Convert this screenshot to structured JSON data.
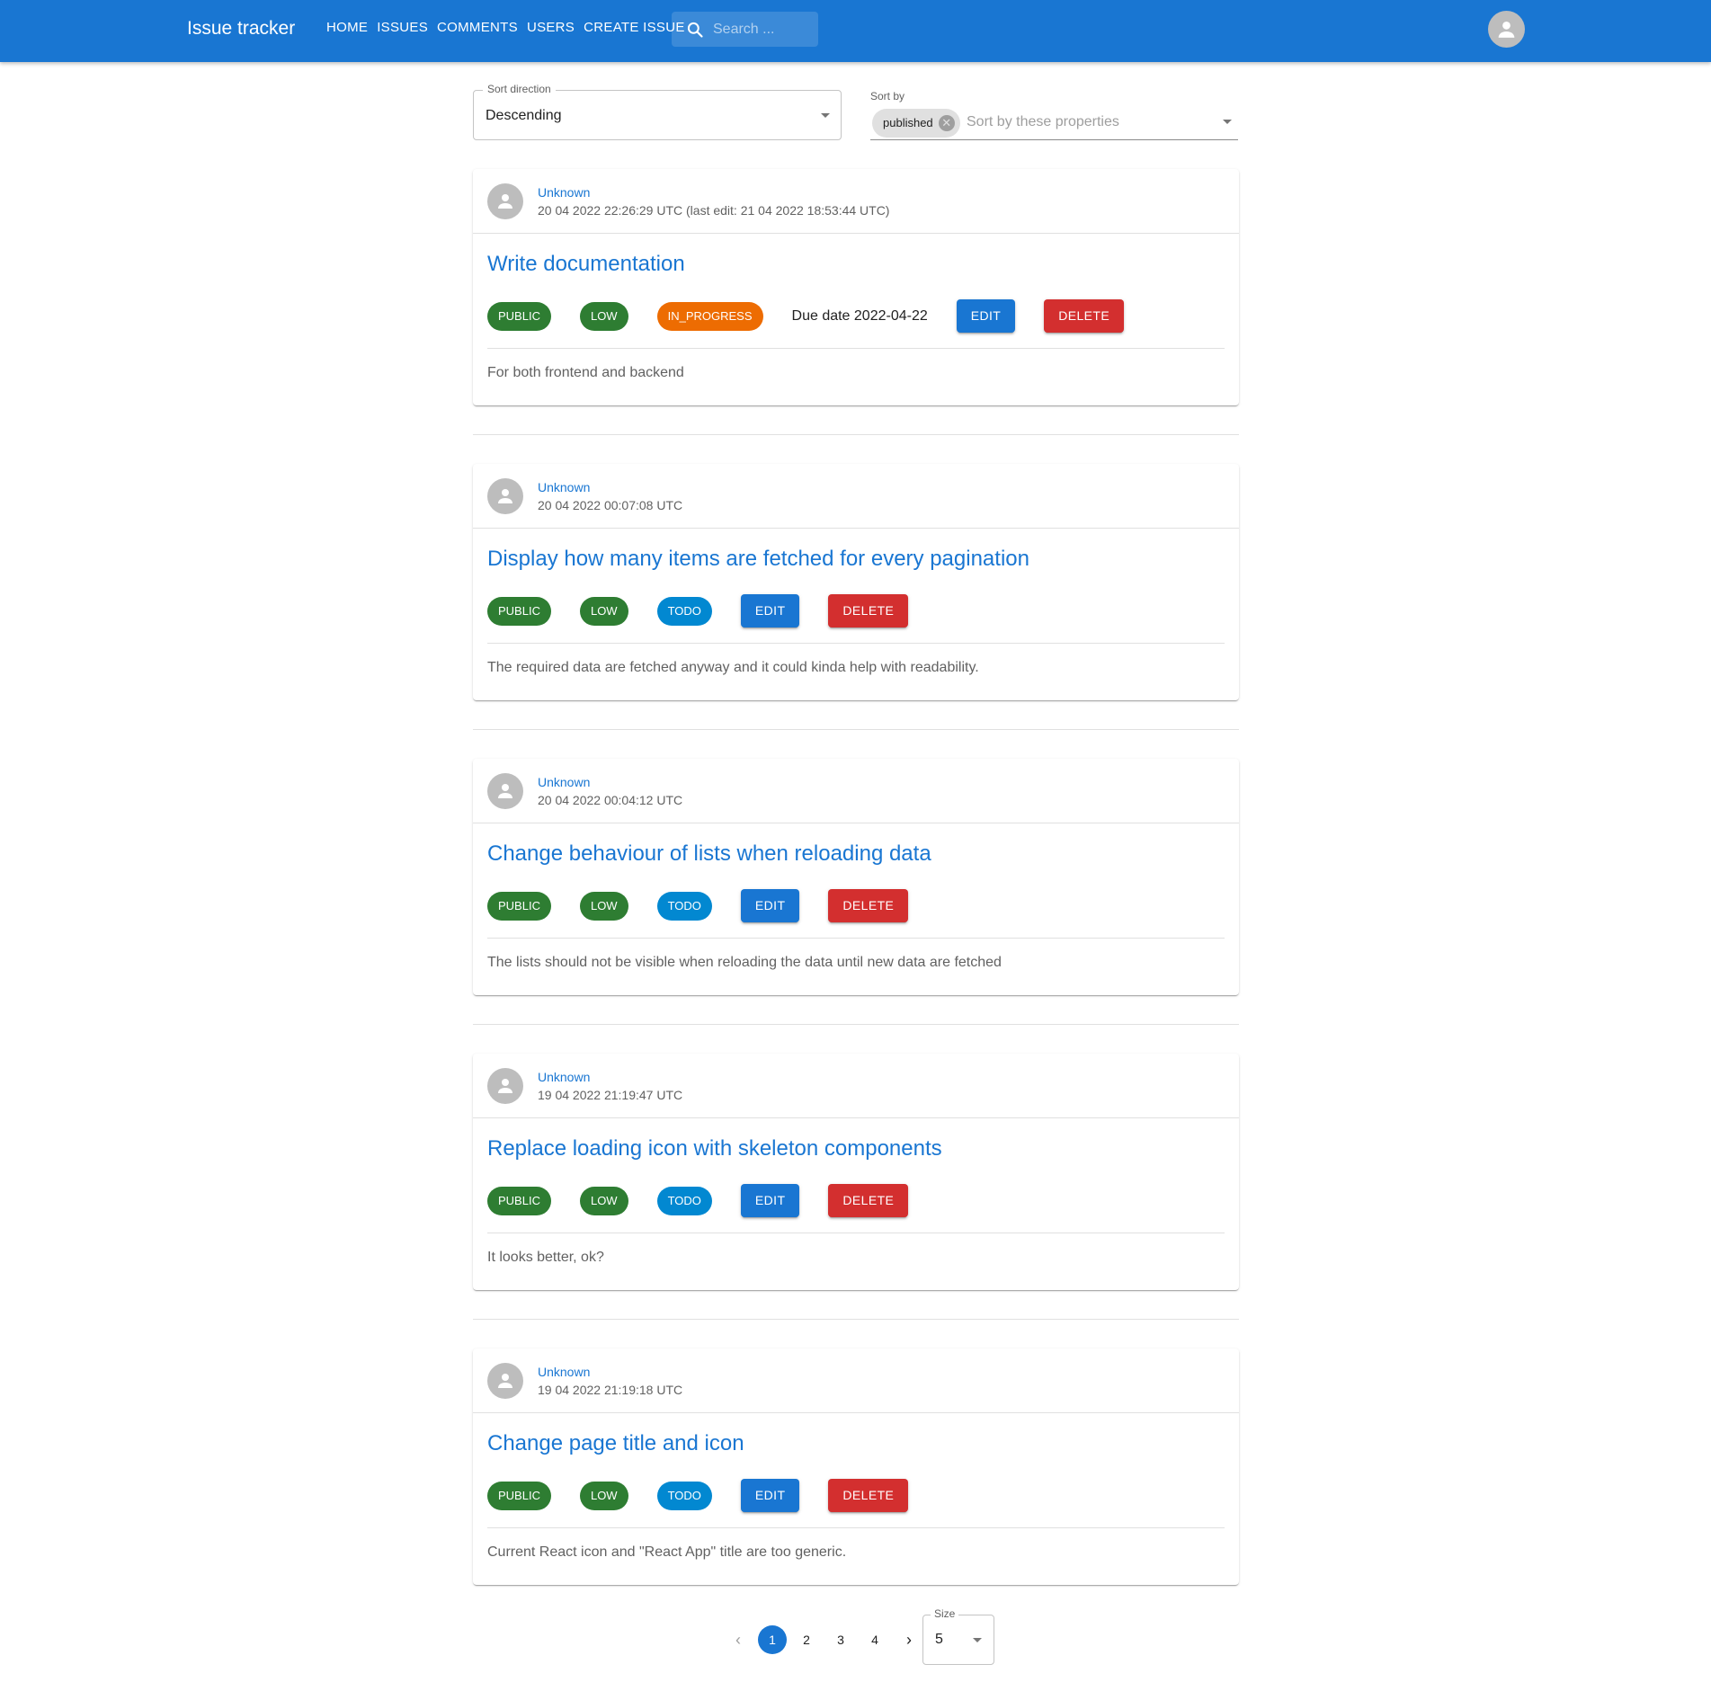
{
  "appbar": {
    "title": "Issue tracker",
    "nav": [
      "HOME",
      "ISSUES",
      "COMMENTS",
      "USERS",
      "CREATE ISSUE"
    ],
    "search_placeholder": "Search ...",
    "color": "#1976d2"
  },
  "sort": {
    "direction_label": "Sort direction",
    "direction_value": "Descending",
    "by_label": "Sort by",
    "by_chip": "published",
    "by_placeholder": "Sort by these properties"
  },
  "issues": [
    {
      "author": "Unknown",
      "date": "20 04 2022 22:26:29 UTC (last edit: 21 04 2022 18:53:44 UTC)",
      "title": "Write documentation",
      "visibility": "PUBLIC",
      "priority": "LOW",
      "state": "IN_PROGRESS",
      "due": "Due date 2022-04-22",
      "edit_label": "EDIT",
      "delete_label": "DELETE",
      "description": "For both frontend and backend"
    },
    {
      "author": "Unknown",
      "date": "20 04 2022 00:07:08 UTC",
      "title": "Display how many items are fetched for every pagination",
      "visibility": "PUBLIC",
      "priority": "LOW",
      "state": "TODO",
      "edit_label": "EDIT",
      "delete_label": "DELETE",
      "description": "The required data are fetched anyway and it could kinda help with readability."
    },
    {
      "author": "Unknown",
      "date": "20 04 2022 00:04:12 UTC",
      "title": "Change behaviour of lists when reloading data",
      "visibility": "PUBLIC",
      "priority": "LOW",
      "state": "TODO",
      "edit_label": "EDIT",
      "delete_label": "DELETE",
      "description": "The lists should not be visible when reloading the data until new data are fetched"
    },
    {
      "author": "Unknown",
      "date": "19 04 2022 21:19:47 UTC",
      "title": "Replace loading icon with skeleton components",
      "visibility": "PUBLIC",
      "priority": "LOW",
      "state": "TODO",
      "edit_label": "EDIT",
      "delete_label": "DELETE",
      "description": "It looks better, ok?"
    },
    {
      "author": "Unknown",
      "date": "19 04 2022 21:19:18 UTC",
      "title": "Change page title and icon",
      "visibility": "PUBLIC",
      "priority": "LOW",
      "state": "TODO",
      "edit_label": "EDIT",
      "delete_label": "DELETE",
      "description": "Current React icon and \"React App\" title are too generic."
    }
  ],
  "pagination": {
    "pages": [
      "1",
      "2",
      "3",
      "4"
    ],
    "current": "1",
    "size_label": "Size",
    "size_value": "5"
  },
  "colors": {
    "primary": "#1976d2",
    "success": "#2e7d32",
    "warning": "#ed6c02",
    "info": "#0288d1",
    "error": "#d32f2f"
  },
  "icons": {
    "search": "search-icon",
    "account": "account-circle-icon",
    "avatar": "person-icon",
    "chip_delete": "cancel-icon",
    "dropdown": "arrow-drop-down-icon",
    "prev": "chevron-left-icon",
    "next": "chevron-right-icon"
  }
}
